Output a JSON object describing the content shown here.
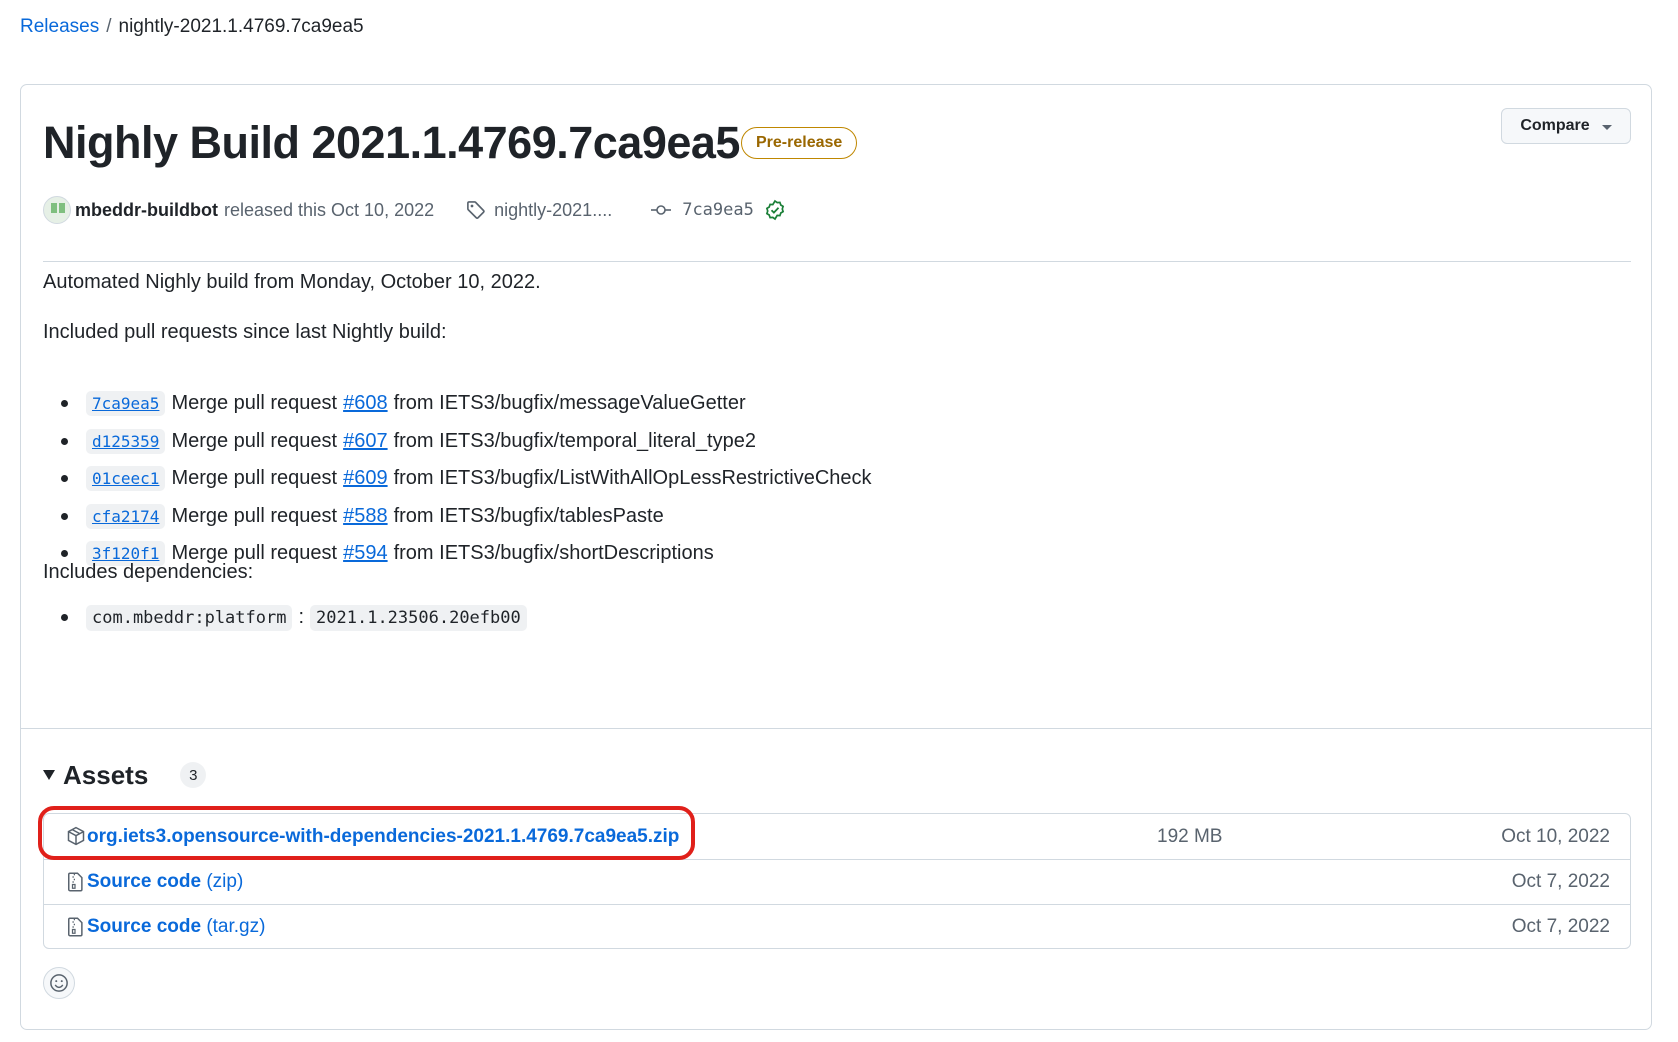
{
  "breadcrumb": {
    "releases_label": "Releases",
    "separator": "/",
    "current": "nightly-2021.1.4769.7ca9ea5"
  },
  "release": {
    "title": "Nighly Build 2021.1.4769.7ca9ea5",
    "badge": "Pre-release",
    "compare_label": "Compare",
    "author": "mbeddr-buildbot",
    "released_text": "released this Oct 10, 2022",
    "tag": "nightly-2021....",
    "commit": "7ca9ea5"
  },
  "body": {
    "intro": "Automated Nighly build from Monday, October 10, 2022.",
    "prs_heading": "Included pull requests since last Nightly build:",
    "pull_requests": [
      {
        "sha": "7ca9ea5",
        "prefix": "Merge pull request",
        "number": "#608",
        "from": "from IETS3/bugfix/messageValueGetter"
      },
      {
        "sha": "d125359",
        "prefix": "Merge pull request",
        "number": "#607",
        "from": "from IETS3/bugfix/temporal_literal_type2"
      },
      {
        "sha": "01ceec1",
        "prefix": "Merge pull request",
        "number": "#609",
        "from": "from IETS3/bugfix/ListWithAllOpLessRestrictiveCheck"
      },
      {
        "sha": "cfa2174",
        "prefix": "Merge pull request",
        "number": "#588",
        "from": "from IETS3/bugfix/tablesPaste"
      },
      {
        "sha": "3f120f1",
        "prefix": "Merge pull request",
        "number": "#594",
        "from": "from IETS3/bugfix/shortDescriptions"
      }
    ],
    "deps_heading": "Includes dependencies:",
    "dependency": {
      "name": "com.mbeddr:platform",
      "separator": ":",
      "version": "2021.1.23506.20efb00"
    }
  },
  "assets": {
    "label": "Assets",
    "count": "3",
    "items": [
      {
        "name": "org.iets3.opensource-with-dependencies-2021.1.4769.7ca9ea5.zip",
        "suffix": "",
        "size": "192 MB",
        "date": "Oct 10, 2022",
        "icon": "package-icon"
      },
      {
        "name": "Source code",
        "suffix": "(zip)",
        "size": "",
        "date": "Oct 7, 2022",
        "icon": "file-zip-icon"
      },
      {
        "name": "Source code",
        "suffix": "(tar.gz)",
        "size": "",
        "date": "Oct 7, 2022",
        "icon": "file-zip-icon"
      }
    ]
  },
  "colors": {
    "link": "#0969da",
    "prerelease": "#9a6700",
    "verified": "#1a7f37",
    "highlight": "#e0201a",
    "border": "#d1d9e0"
  }
}
